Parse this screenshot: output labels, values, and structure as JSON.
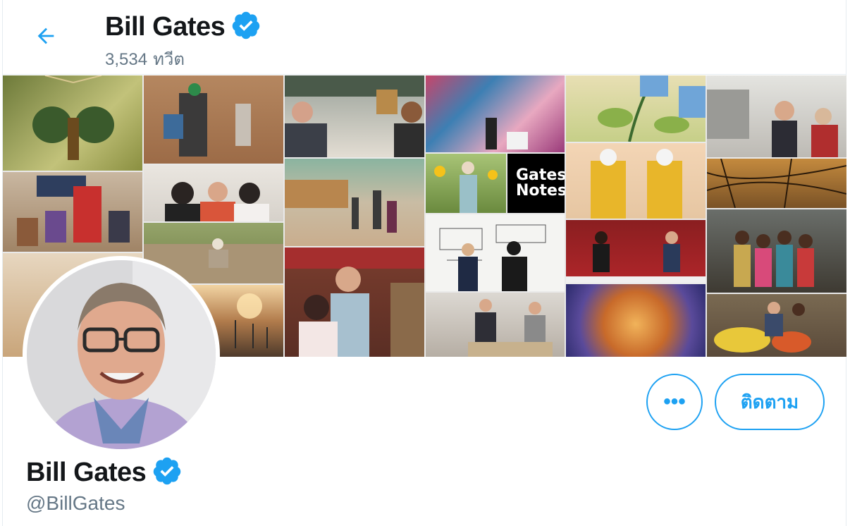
{
  "header": {
    "name": "Bill Gates",
    "tweet_count": "3,534",
    "tweet_label": "ทวีต",
    "back_icon": "arrow-left-icon",
    "verified_icon": "verified-badge-icon"
  },
  "banner": {
    "gates_notes_line1": "Gates",
    "gates_notes_line2": "Notes"
  },
  "profile": {
    "name": "Bill Gates",
    "handle": "@BillGates"
  },
  "actions": {
    "more_label": "•••",
    "follow_label": "ติดตาม"
  },
  "colors": {
    "accent": "#1da1f2",
    "secondary_text": "#657786",
    "primary_text": "#14171a"
  }
}
